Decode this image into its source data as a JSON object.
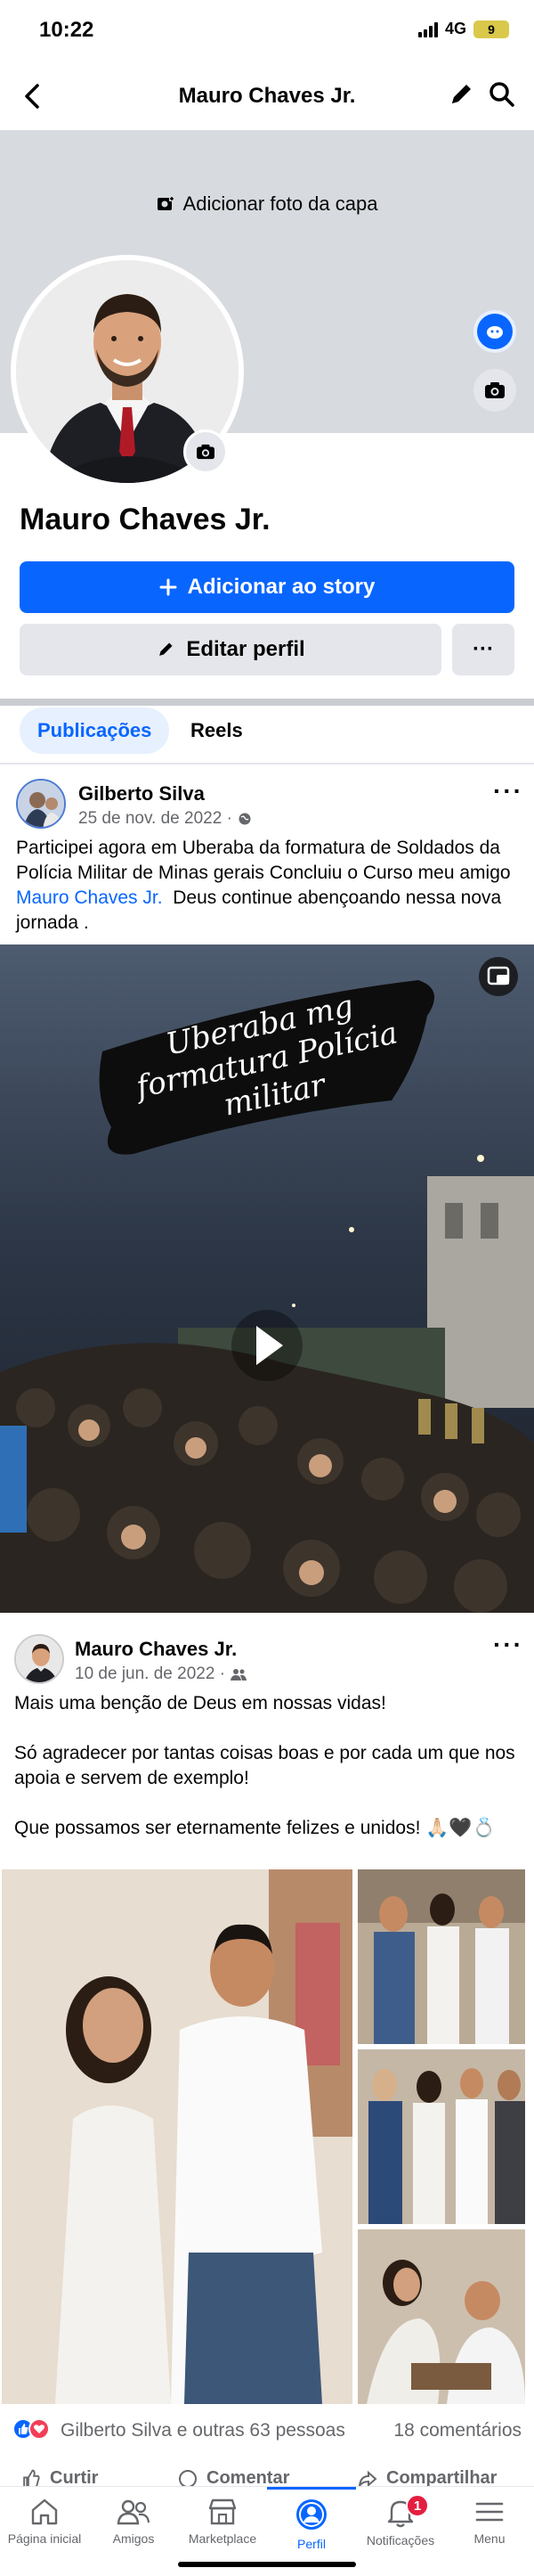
{
  "status_bar": {
    "time": "10:22",
    "network": "4G",
    "battery": "9"
  },
  "header": {
    "title": "Mauro Chaves Jr.",
    "back_icon": "back-arrow-icon",
    "edit_icon": "pencil-icon",
    "search_icon": "search-icon"
  },
  "cover": {
    "add_cover_label": "Adicionar foto da capa"
  },
  "profile": {
    "name": "Mauro Chaves Jr.",
    "add_story_label": "Adicionar ao story",
    "edit_profile_label": "Editar perfil",
    "more_label": "···"
  },
  "tabs": [
    {
      "label": "Publicações",
      "active": true
    },
    {
      "label": "Reels",
      "active": false
    }
  ],
  "post1": {
    "author": "Gilberto Silva",
    "date": "25 de nov. de 2022 ·",
    "text_before": "Participei agora em Uberaba da formatura de Soldados da Polícia Militar de Minas gerais Concluiu o Curso meu amigo ",
    "mention": "Mauro Chaves Jr.",
    "text_after": "  Deus continue abençoando nessa nova jornada .",
    "video_caption_line1": "Uberaba mg",
    "video_caption_line2": "formatura Polícia",
    "video_caption_line3": "militar"
  },
  "post2": {
    "author": "Mauro Chaves Jr.",
    "date": "10 de jun. de 2022 ·",
    "text": "Mais uma benção de Deus em nossas vidas!\n\nSó agradecer por tantas coisas boas e por cada um que nos apoia e servem de exemplo!\n\nQue possamos ser eternamente felizes e unidos! 🙏🏻🖤💍"
  },
  "reactions": {
    "summary": "Gilberto Silva e outras 63 pessoas",
    "comments": "18 comentários"
  },
  "actions": {
    "like": "Curtir",
    "comment": "Comentar",
    "share": "Compartilhar"
  },
  "bottom_nav": [
    {
      "label": "Página inicial",
      "icon": "home-icon"
    },
    {
      "label": "Amigos",
      "icon": "friends-icon"
    },
    {
      "label": "Marketplace",
      "icon": "marketplace-icon"
    },
    {
      "label": "Perfil",
      "icon": "profile-icon",
      "active": true
    },
    {
      "label": "Notificações",
      "icon": "bell-icon",
      "badge": "1"
    },
    {
      "label": "Menu",
      "icon": "menu-icon"
    }
  ],
  "colors": {
    "accent": "#0866ff",
    "badge": "#e41e3f",
    "cover": "#d7dade"
  }
}
